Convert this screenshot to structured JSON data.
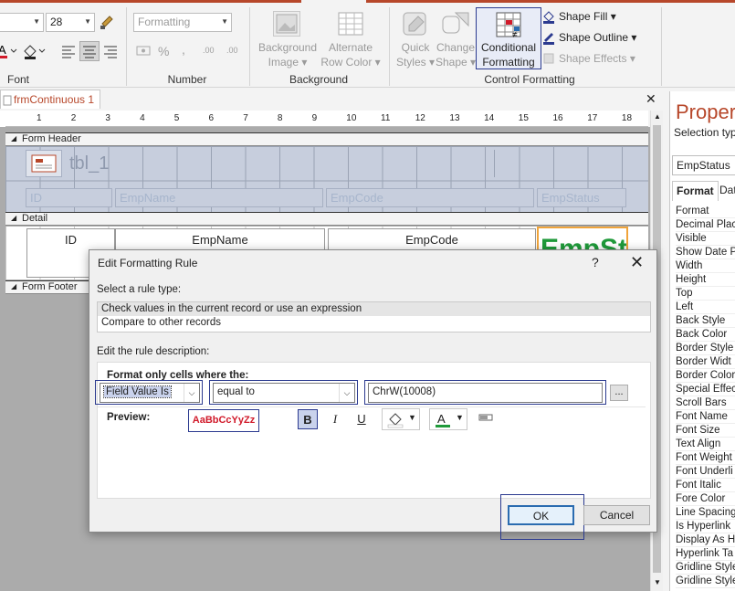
{
  "ribbon": {
    "font_size_value": "28",
    "number_format_placeholder": "Formatting",
    "groups": {
      "font": "Font",
      "number": "Number",
      "background": "Background",
      "control_formatting": "Control Formatting"
    },
    "number_symbols": {
      "percent": "%",
      "comma": ",",
      "inc_decimal": ".00",
      "dec_decimal": ".00"
    },
    "buttons": {
      "background_image": [
        "Background",
        "Image"
      ],
      "alternate_row_color": [
        "Alternate",
        "Row Color"
      ],
      "quick_styles": [
        "Quick",
        "Styles"
      ],
      "change_shape": [
        "Change",
        "Shape"
      ],
      "conditional_formatting": [
        "Conditional",
        "Formatting"
      ],
      "shape_fill": "Shape Fill",
      "shape_outline": "Shape Outline",
      "shape_effects": "Shape Effects"
    }
  },
  "document": {
    "tab_title": "frmContinuous 1",
    "close_glyph": "✕",
    "ruler_numbers": [
      "1",
      "2",
      "3",
      "4",
      "5",
      "6",
      "7",
      "8",
      "9",
      "10",
      "11",
      "12",
      "13",
      "14",
      "15",
      "16",
      "17",
      "18"
    ],
    "sections": {
      "header": "Form Header",
      "detail": "Detail",
      "footer": "Form Footer"
    },
    "header_title": "tbl_1",
    "header_labels": [
      "ID",
      "EmpName",
      "EmpCode",
      "EmpStatus"
    ],
    "detail_fields": [
      "ID",
      "EmpName",
      "EmpCode"
    ]
  },
  "property_sheet": {
    "title": "Propert",
    "selection_type": "Selection typ",
    "selected_control": "EmpStatus",
    "tabs": [
      "Format",
      "Dat"
    ],
    "properties": [
      "Format",
      "Decimal Plac",
      "Visible",
      "Show Date P",
      "Width",
      "Height",
      "Top",
      "Left",
      "Back Style",
      "Back Color",
      "Border Style",
      "Border Widt",
      "Border Color",
      "Special Effec",
      "Scroll Bars",
      "Font Name",
      "Font Size",
      "Text Align",
      "Font Weight",
      "Font Underli",
      "Font Italic",
      "Fore Color",
      "Line Spacing",
      "Is Hyperlink",
      "Display As H",
      "Hyperlink Ta",
      "Gridline Style",
      "Gridline Style"
    ]
  },
  "dialog": {
    "title": "Edit Formatting Rule",
    "help_glyph": "?",
    "close_glyph": "✕",
    "select_rule_type_label": "Select a rule type:",
    "rule_types": [
      "Check values in the current record or use an expression",
      "Compare to other records"
    ],
    "selected_rule_index": 0,
    "edit_description_label": "Edit the rule description:",
    "format_only_label": "Format only cells where the:",
    "condition_type": "Field Value Is",
    "operator": "equal to",
    "expression_value": "ChrW(10008)",
    "ellipsis_label": "...",
    "preview_label": "Preview:",
    "preview_sample": "AaBbCcYyZz",
    "preview_color": "#d11a2a",
    "bold_label": "B",
    "italic_label": "I",
    "underline_label": "U",
    "ok_label": "OK",
    "cancel_label": "Cancel"
  }
}
